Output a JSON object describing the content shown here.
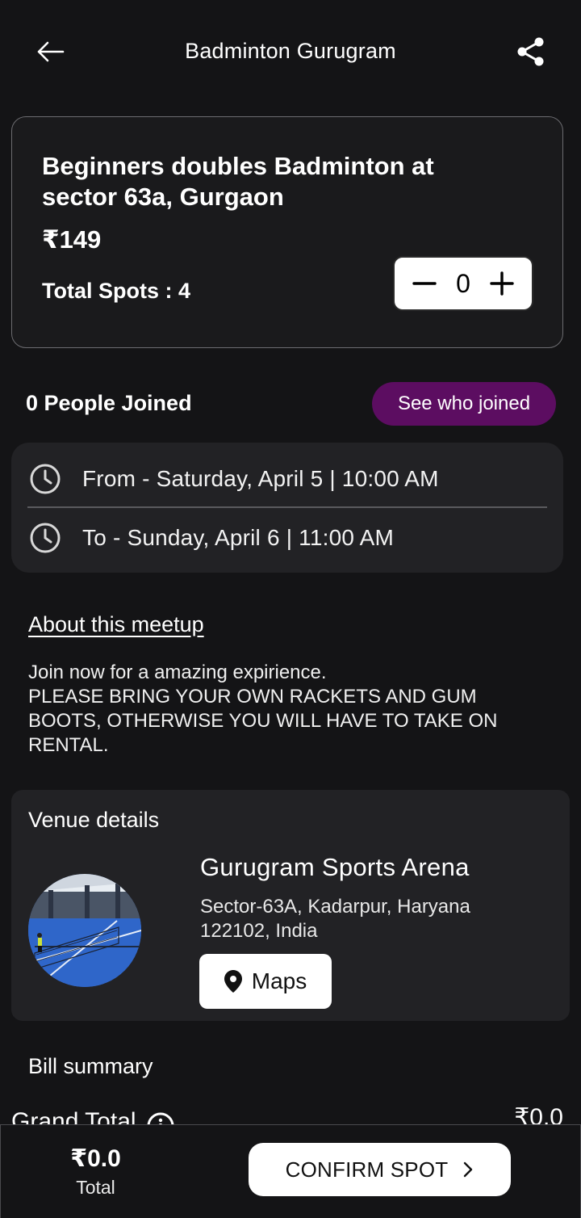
{
  "header": {
    "title": "Badminton Gurugram",
    "back_icon": "arrow-left-icon",
    "share_icon": "share-icon"
  },
  "event": {
    "title": "Beginners doubles Badminton at sector 63a, Gurgaon",
    "price": "₹149",
    "spots": "Total Spots : 4",
    "quantity": "0"
  },
  "joined": {
    "label": "0 People Joined",
    "button_label": "See who joined",
    "button_color": "#5c0d61"
  },
  "schedule": {
    "from": "From - Saturday, April 5 | 10:00 AM",
    "to": "To - Sunday, April 6 | 11:00 AM"
  },
  "about": {
    "heading": "About this meetup",
    "text": "Join now for a amazing expirience.\nPLEASE BRING YOUR OWN RACKETS AND GUM BOOTS, OTHERWISE YOU WILL HAVE TO TAKE ON RENTAL."
  },
  "venue": {
    "heading": "Venue details",
    "name": "Gurugram Sports Arena",
    "address": "Sector-63A, Kadarpur, Haryana 122102, India",
    "maps_label": "Maps"
  },
  "bill": {
    "heading": "Bill summary",
    "grand_total_label": "Grand Total",
    "grand_total_value": "₹0.0"
  },
  "bottom": {
    "total_amount": "₹0.0",
    "total_label": "Total",
    "confirm_label": "CONFIRM SPOT"
  }
}
